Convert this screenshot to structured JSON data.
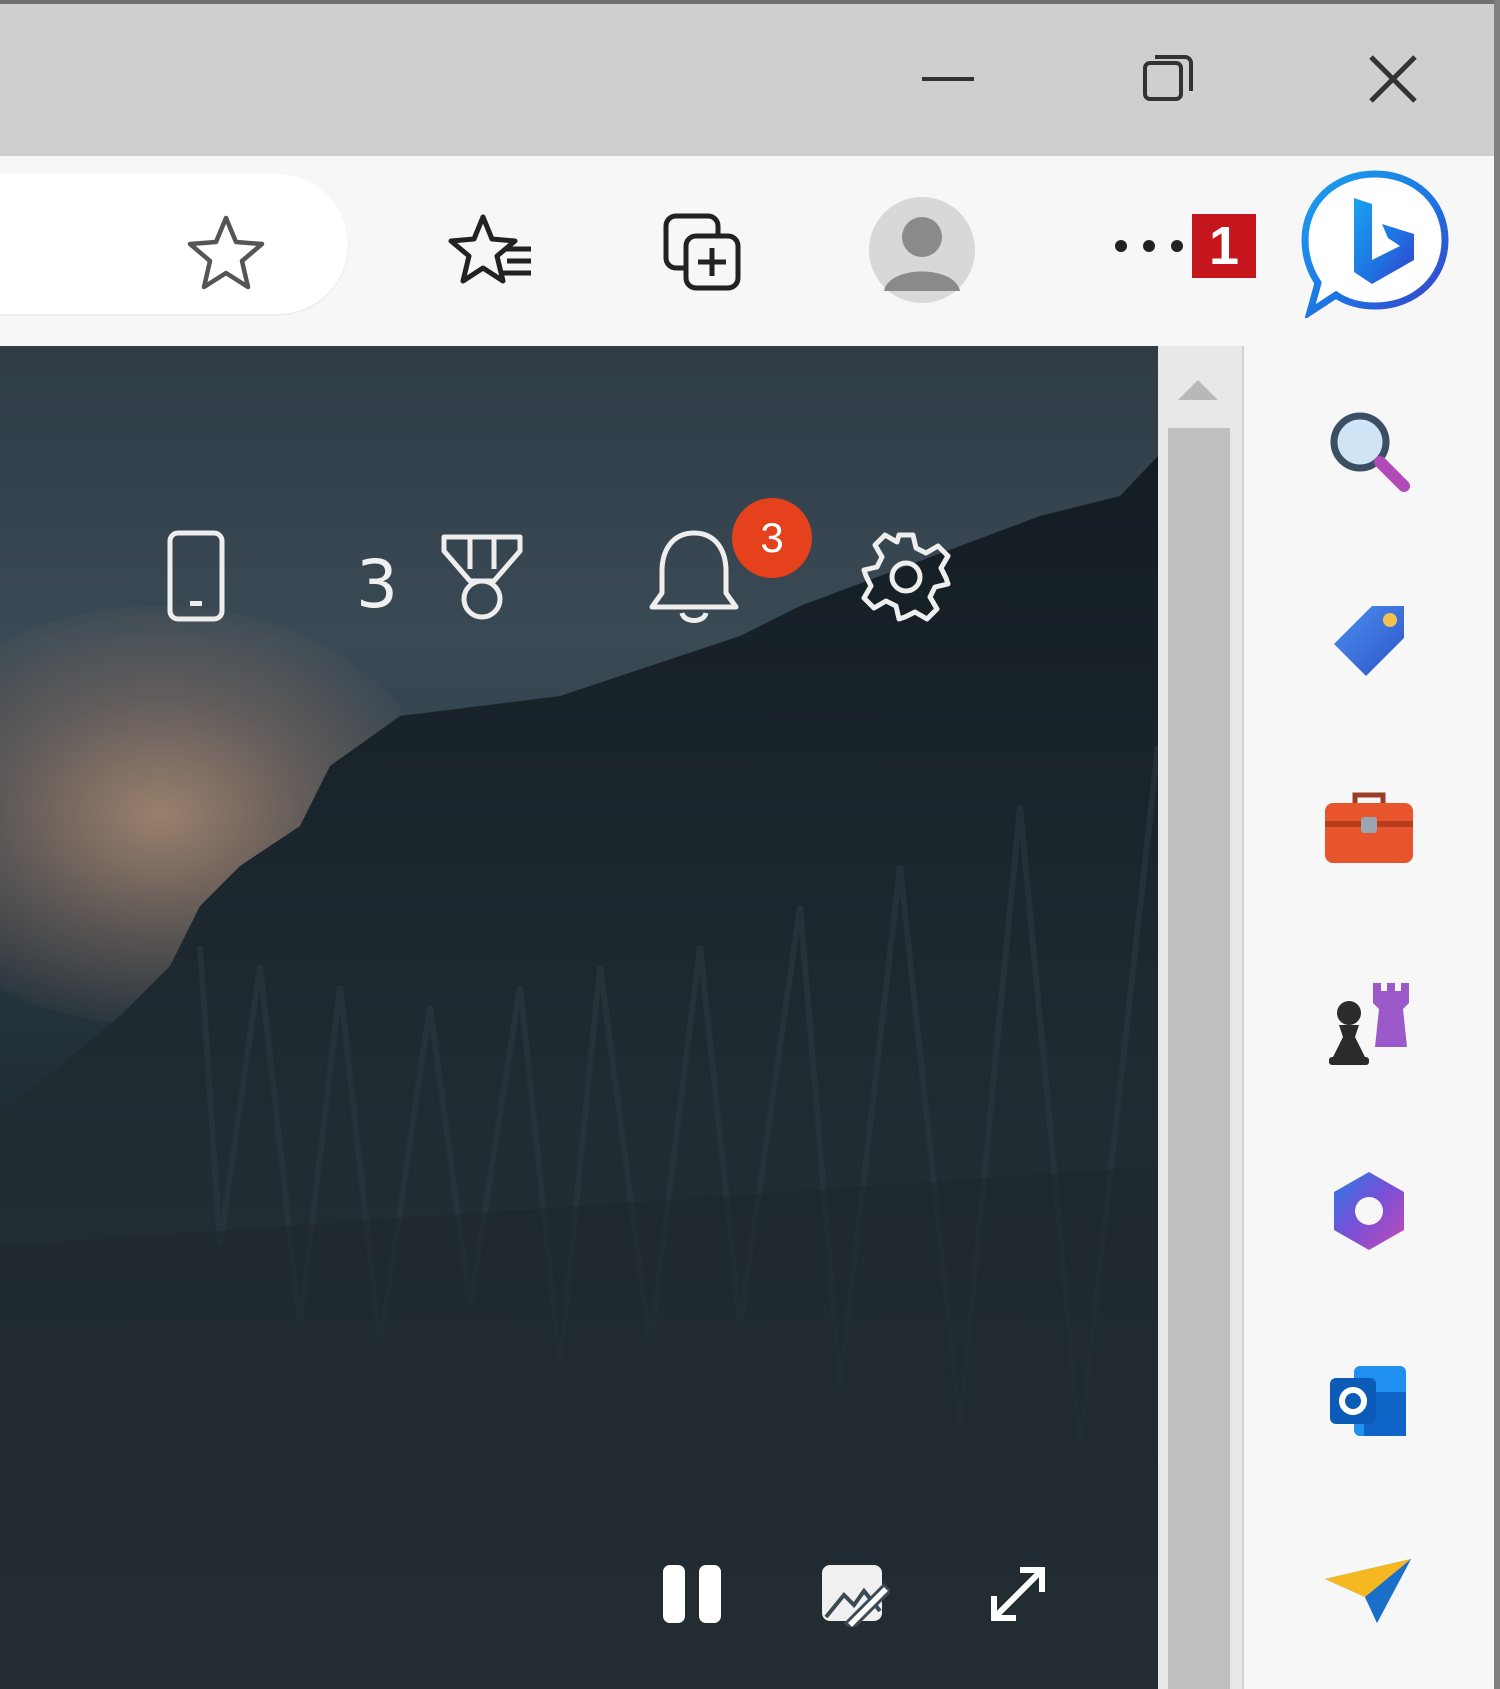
{
  "window": {
    "minimize_icon": "minimize-icon",
    "restore_icon": "restore-icon",
    "close_icon": "close-icon"
  },
  "toolbar": {
    "favorite_icon": "star-icon",
    "favorites_icon": "favorites-list-icon",
    "collections_icon": "collections-icon",
    "profile_icon": "profile-avatar-icon",
    "more_icon": "more-dots-icon",
    "callout_label": "1",
    "bing_icon": "bing-chat-icon",
    "colors": {
      "callout": "#c4161c",
      "bing": "#1f7fe0"
    }
  },
  "newtab": {
    "phone_icon": "phone-icon",
    "rewards_count": "3",
    "rewards_icon": "medal-icon",
    "notifications_icon": "bell-icon",
    "notifications_count": "3",
    "settings_icon": "gear-icon",
    "pause_icon": "pause-icon",
    "edit_background_icon": "edit-image-icon",
    "expand_icon": "expand-icon",
    "colors": {
      "notification_badge": "#e4411c"
    }
  },
  "sidebar": {
    "items": [
      {
        "icon": "search-icon"
      },
      {
        "icon": "shopping-tag-icon"
      },
      {
        "icon": "tools-icon"
      },
      {
        "icon": "games-icon"
      },
      {
        "icon": "microsoft-365-icon"
      },
      {
        "icon": "outlook-icon"
      },
      {
        "icon": "drop-icon"
      }
    ]
  }
}
